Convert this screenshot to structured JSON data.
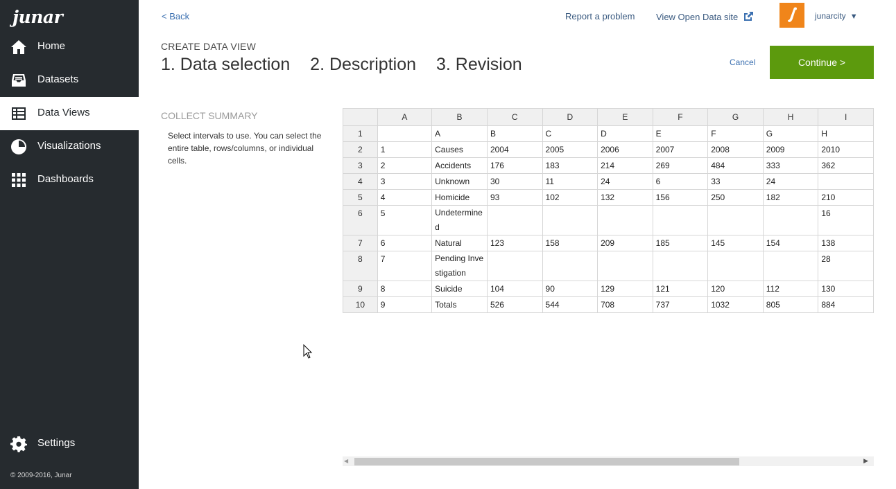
{
  "brand": {
    "logo_text": "junar"
  },
  "nav": {
    "home": "Home",
    "datasets": "Datasets",
    "data_views": "Data Views",
    "visualizations": "Visualizations",
    "dashboards": "Dashboards",
    "settings": "Settings",
    "copyright": "© 2009-2016, Junar"
  },
  "topbar": {
    "back": "< Back",
    "report": "Report a problem",
    "open_data": "View Open Data site",
    "user": "junarcity",
    "user_caret": "▼"
  },
  "header": {
    "create_label": "CREATE DATA VIEW",
    "steps": [
      "1. Data selection",
      "2. Description",
      "3. Revision"
    ],
    "cancel": "Cancel",
    "continue": "Continue >"
  },
  "collect": {
    "title": "COLLECT SUMMARY",
    "description": "Select intervals to use. You can select the entire table, rows/columns, or individual cells."
  },
  "grid": {
    "columns": [
      "A",
      "B",
      "C",
      "D",
      "E",
      "F",
      "G",
      "H",
      "I"
    ],
    "rows": [
      [
        "1",
        "",
        "A",
        "B",
        "C",
        "D",
        "E",
        "F",
        "G",
        "H"
      ],
      [
        "2",
        "1",
        "Causes",
        "2004",
        "2005",
        "2006",
        "2007",
        "2008",
        "2009",
        "2010"
      ],
      [
        "3",
        "2",
        "Accidents",
        "176",
        "183",
        "214",
        "269",
        "484",
        "333",
        "362"
      ],
      [
        "4",
        "3",
        "Unknown",
        "30",
        "11",
        "24",
        "6",
        "33",
        "24",
        ""
      ],
      [
        "5",
        "4",
        "Homicide",
        "93",
        "102",
        "132",
        "156",
        "250",
        "182",
        "210"
      ],
      [
        "6",
        "5",
        "Undetermined",
        "",
        "",
        "",
        "",
        "",
        "",
        "16"
      ],
      [
        "7",
        "6",
        "Natural",
        "123",
        "158",
        "209",
        "185",
        "145",
        "154",
        "138"
      ],
      [
        "8",
        "7",
        "Pending Investigation",
        "",
        "",
        "",
        "",
        "",
        "",
        "28"
      ],
      [
        "9",
        "8",
        "Suicide",
        "104",
        "90",
        "129",
        "121",
        "120",
        "112",
        "130"
      ],
      [
        "10",
        "9",
        "Totals",
        "526",
        "544",
        "708",
        "737",
        "1032",
        "805",
        "884"
      ]
    ]
  },
  "colors": {
    "sidebar": "#262b2f",
    "accent": "#5c9a0d",
    "avatar": "#f0851a",
    "link": "#3a6fb0"
  }
}
